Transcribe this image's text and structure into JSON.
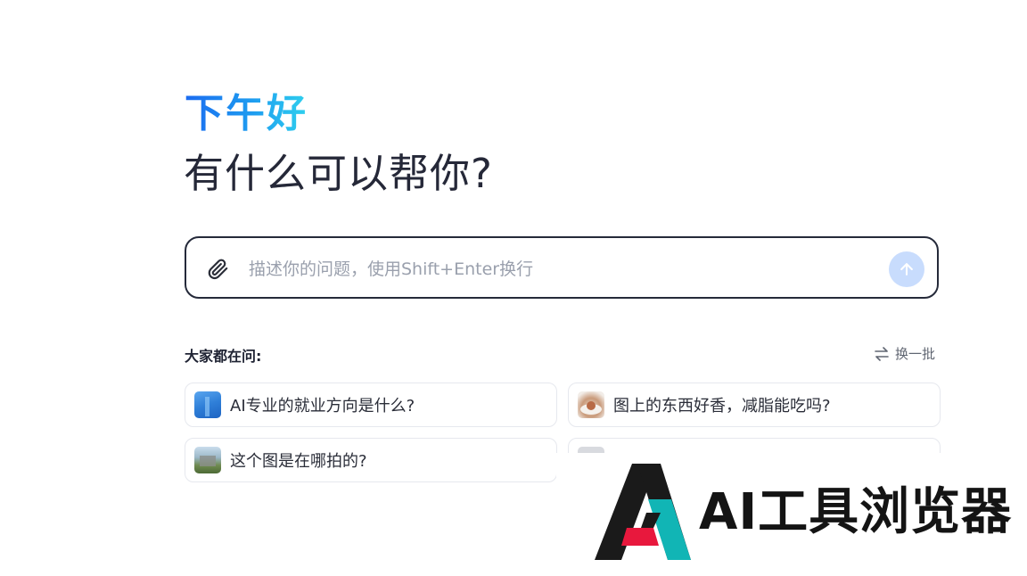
{
  "greeting": "下午好",
  "headline": "有什么可以帮你?",
  "chat": {
    "placeholder": "描述你的问题，使用Shift+Enter换行"
  },
  "suggestions": {
    "title": "大家都在问:",
    "refresh_label": "换一批",
    "items": [
      {
        "text": "AI专业的就业方向是什么?"
      },
      {
        "text": "图上的东西好香，减脂能吃吗?"
      },
      {
        "text": "这个图是在哪拍的?"
      },
      {
        "text": ""
      }
    ]
  },
  "watermark": {
    "text": "AI工具浏览器"
  },
  "colors": {
    "accent": "#1b6bf0",
    "send_button": "#c8dcfd",
    "border": "#252a3a"
  }
}
